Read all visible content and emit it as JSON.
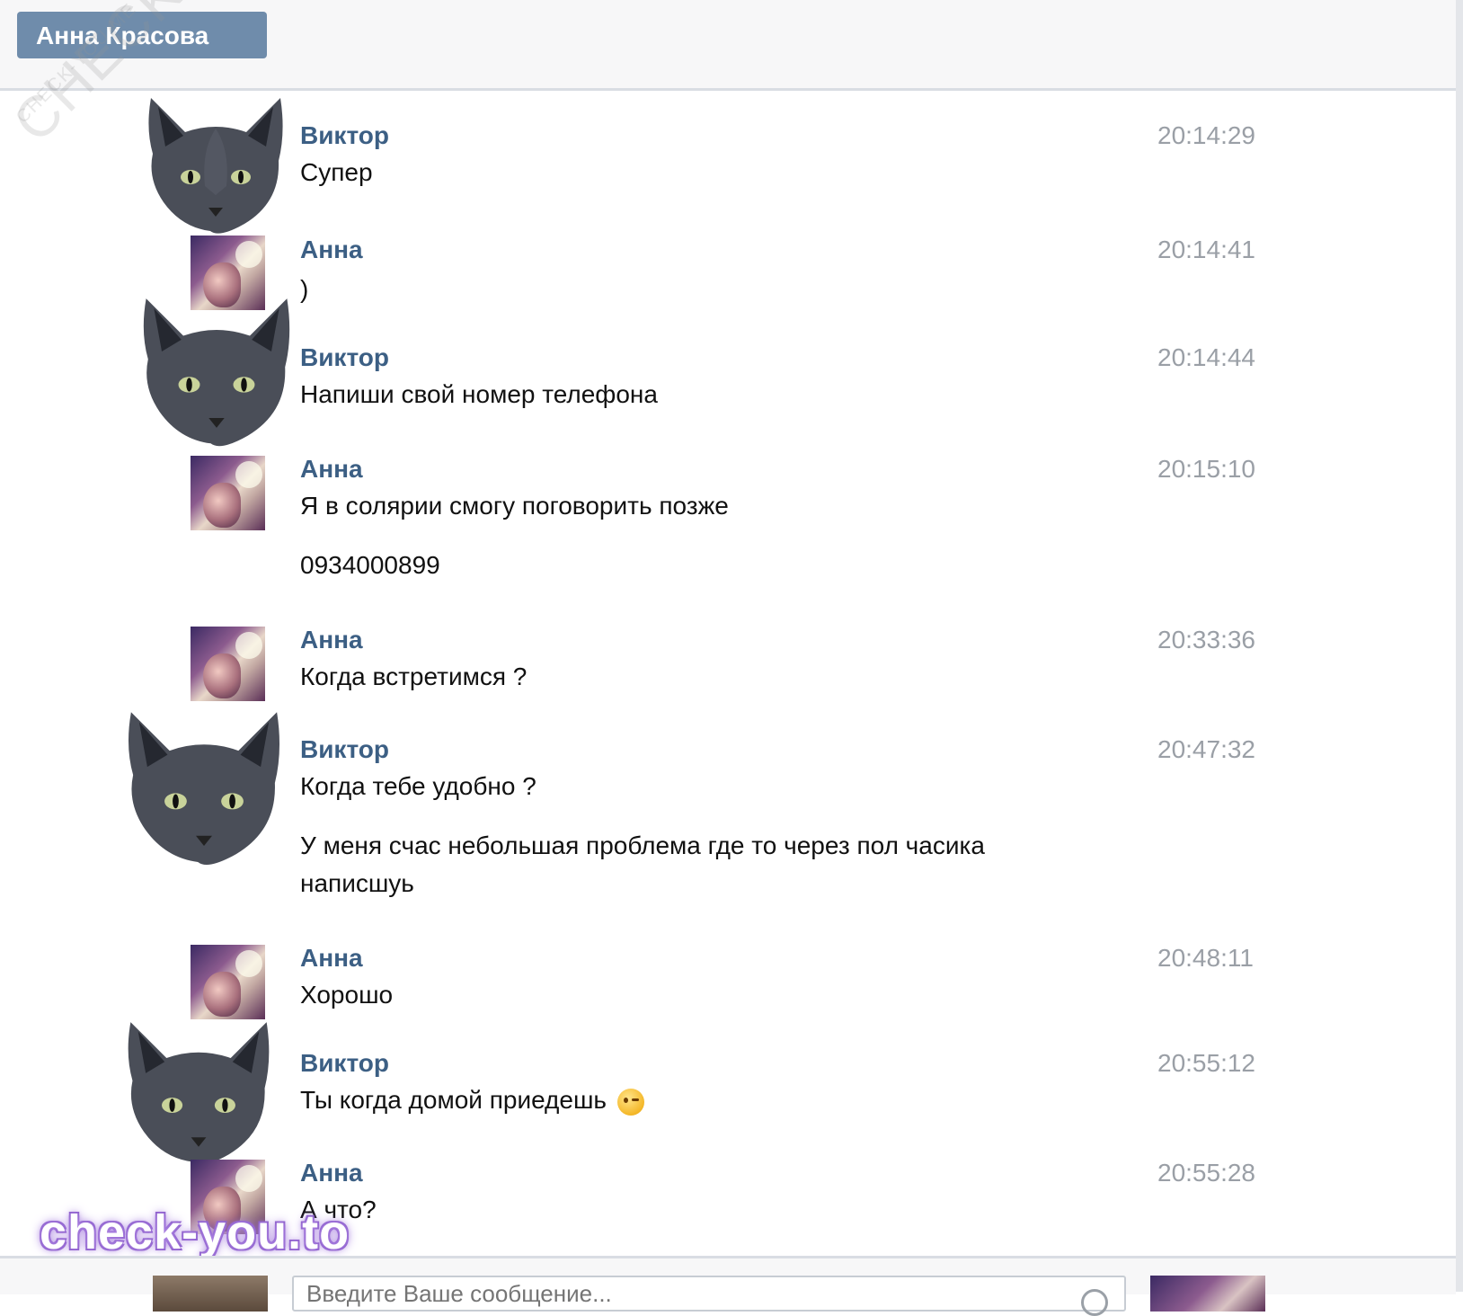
{
  "header": {
    "contact_name": "Анна Красова"
  },
  "watermark": {
    "diagonal_text": "CHECK-YOU.ME",
    "brand_text": "check-you.to"
  },
  "messages": [
    {
      "author": "Виктор",
      "time": "20:14:29",
      "lines": [
        "Супер"
      ]
    },
    {
      "author": "Анна",
      "time": "20:14:41",
      "lines": [
        ")"
      ]
    },
    {
      "author": "Виктор",
      "time": "20:14:44",
      "lines": [
        "Напиши свой номер телефона"
      ]
    },
    {
      "author": "Анна",
      "time": "20:15:10",
      "lines": [
        "Я в солярии смогу поговорить позже",
        "0934000899"
      ]
    },
    {
      "author": "Анна",
      "time": "20:33:36",
      "lines": [
        "Когда встретимся ?"
      ]
    },
    {
      "author": "Виктор",
      "time": "20:47:32",
      "lines": [
        "Когда тебе удобно ?",
        "У меня счас небольшая проблема где то через пол часика написшуь"
      ]
    },
    {
      "author": "Анна",
      "time": "20:48:11",
      "lines": [
        "Хорошо"
      ]
    },
    {
      "author": "Виктор",
      "time": "20:55:12",
      "lines": [
        "Ты когда домой приедешь"
      ],
      "emoji": "winking-face"
    },
    {
      "author": "Анна",
      "time": "20:55:28",
      "lines": [
        "А что?"
      ]
    }
  ],
  "composer": {
    "placeholder": "Введите Ваше сообщение..."
  },
  "colors": {
    "author_link": "#3c5f84",
    "timestamp": "#9a9fa6",
    "header_chip": "#6f8cab"
  }
}
